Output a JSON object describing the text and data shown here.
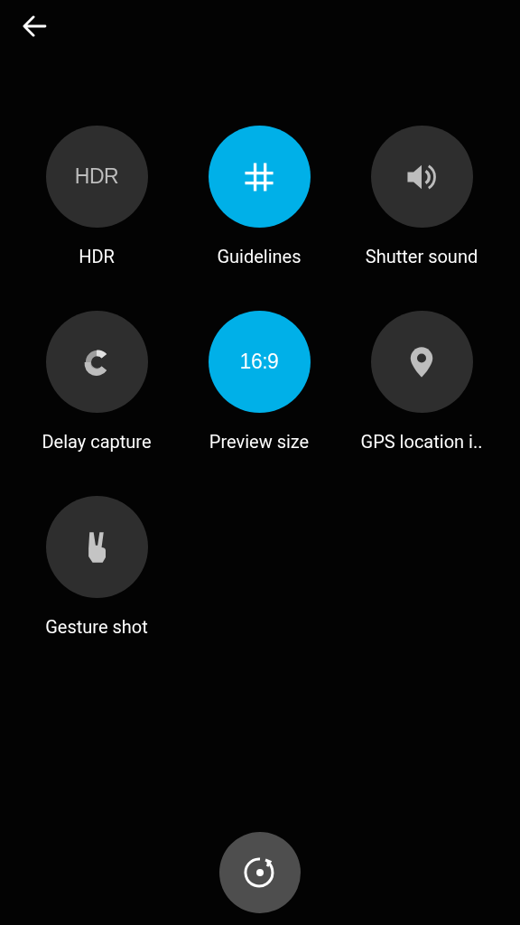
{
  "settings": [
    {
      "label": "HDR",
      "kind": "text",
      "badge": "HDR",
      "on": false
    },
    {
      "label": "Guidelines",
      "kind": "grid",
      "on": true
    },
    {
      "label": "Shutter sound",
      "kind": "speaker",
      "on": false
    },
    {
      "label": "Delay capture",
      "kind": "timer",
      "on": false
    },
    {
      "label": "Preview size",
      "kind": "text",
      "badge": "16:9",
      "on": true
    },
    {
      "label": "GPS location i..",
      "kind": "pin",
      "on": false
    },
    {
      "label": "Gesture shot",
      "kind": "hand",
      "on": false
    }
  ]
}
